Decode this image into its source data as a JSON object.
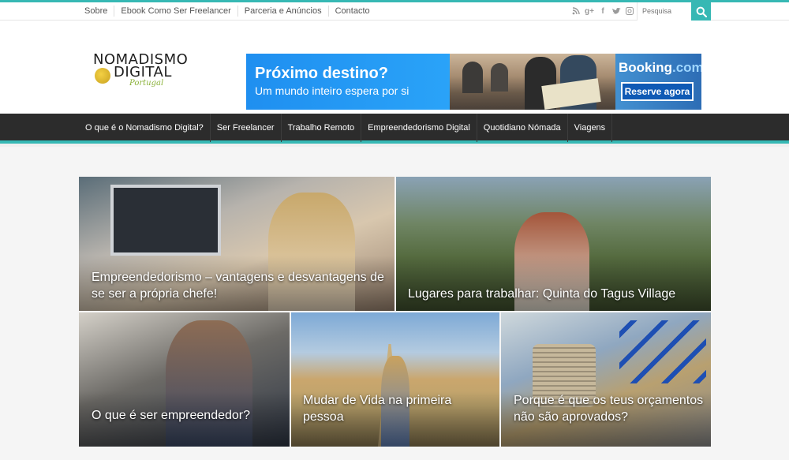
{
  "topbar": {
    "links": [
      "Sobre",
      "Ebook Como Ser Freelancer",
      "Parceria e Anúncios",
      "Contacto"
    ],
    "social_icons": [
      "rss-icon",
      "google-plus-icon",
      "facebook-icon",
      "twitter-icon",
      "instagram-icon"
    ],
    "search_placeholder": "Pesquisa"
  },
  "logo": {
    "line1": "NOMADISMO",
    "line2": "DIGITAL",
    "line3": "Portugal"
  },
  "banner": {
    "title": "Próximo destino?",
    "subtitle": "Um mundo inteiro espera por si",
    "brand_main": "Booking",
    "brand_suffix": ".com",
    "cta": "Reserve agora"
  },
  "mainnav": {
    "items": [
      "O que é o Nomadismo Digital?",
      "Ser Freelancer",
      "Trabalho Remoto",
      "Empreendedorismo Digital",
      "Quotidiano Nómada",
      "Viagens"
    ]
  },
  "posts": [
    {
      "title": "Empreendedorismo – vantagens e desvantagens de se ser a própria chefe!"
    },
    {
      "title": "Lugares para trabalhar: Quinta do Tagus Village"
    },
    {
      "title": "O que é ser empreendedor?"
    },
    {
      "title": "Mudar de Vida na primeira pessoa"
    },
    {
      "title": "Porque é que os teus orçamentos não são aprovados?"
    }
  ],
  "colors": {
    "accent": "#37b8b4",
    "nav_bg": "#2c2c2c",
    "banner_blue": "#1f8ff0"
  }
}
